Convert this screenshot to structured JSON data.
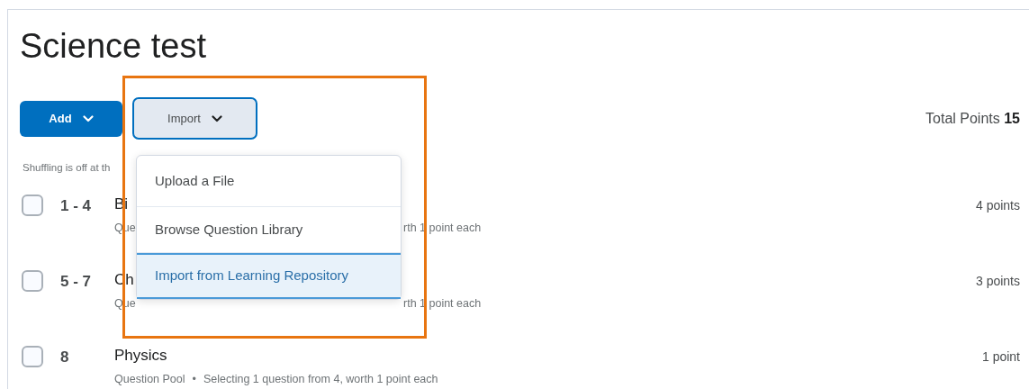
{
  "page": {
    "title": "Science test",
    "add_button": "Add",
    "import_button": "Import",
    "total_points": {
      "label": "Total Points",
      "value": "15"
    },
    "shuffle_note": "Shuffling is off at th"
  },
  "rows": [
    {
      "number": "1 - 4",
      "title": "Bi",
      "kind": "covered",
      "meta": [
        "Que",
        "rth 1 point each"
      ],
      "points": "4 points",
      "checked": false
    },
    {
      "number": "5 - 7",
      "title": "Ch",
      "kind": "covered",
      "meta": [
        "Que",
        "rth 1 point each"
      ],
      "points": "3 points",
      "checked": false
    },
    {
      "number": "8",
      "title": "Physics",
      "kind": "full",
      "meta": [
        "Question Pool",
        "•",
        "Selecting 1 question from 4, worth 1 point each"
      ],
      "points": "1 point",
      "checked": false
    }
  ],
  "import_menu": [
    {
      "label": "Upload a File",
      "selected": false
    },
    {
      "label": "Browse Question Library",
      "selected": false
    },
    {
      "label": "Import from Learning Repository",
      "selected": true
    }
  ]
}
